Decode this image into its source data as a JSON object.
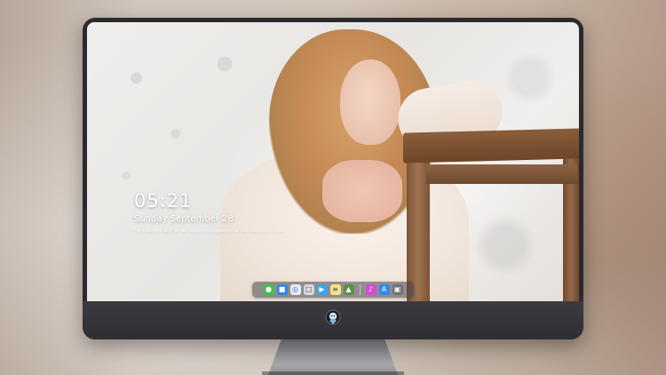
{
  "lockscreen": {
    "time": "05:21",
    "date": "Sunday September  28",
    "note": "Thank you very much for your support and suggestions for your customization work"
  },
  "dock": {
    "icons": [
      "messages-icon",
      "finder-icon",
      "safari-icon",
      "photos-icon",
      "camera-icon",
      "notes-icon",
      "preview-icon",
      "itunes-icon",
      "app-store-icon",
      "screenshot-icon"
    ]
  },
  "colors": {
    "monitor": "#2b2b2e",
    "dock": "#464649",
    "chair": "#7b5335",
    "hair": "#c48a55"
  }
}
